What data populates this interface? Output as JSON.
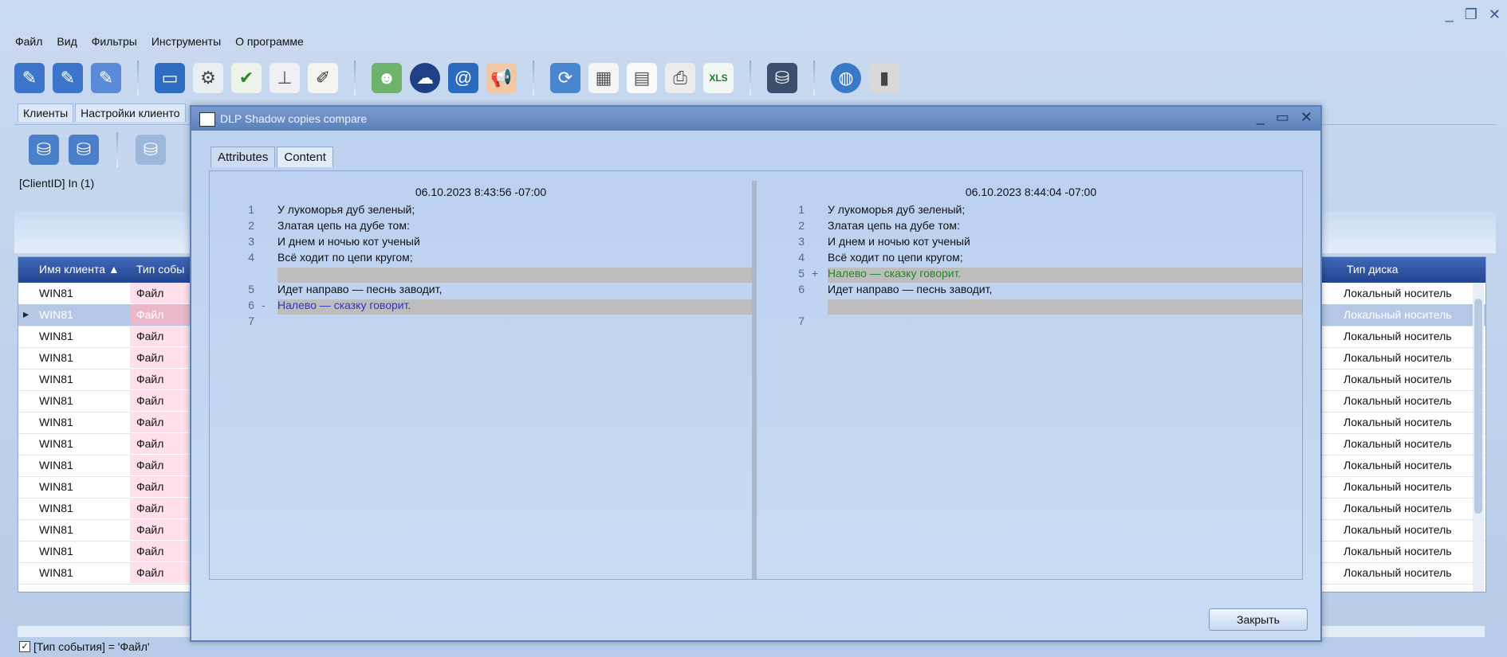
{
  "menubar": [
    "Файл",
    "Вид",
    "Фильтры",
    "Инструменты",
    "О программе"
  ],
  "window_controls": [
    "_",
    "❐",
    "✕"
  ],
  "main_tabs": [
    "Клиенты",
    "Настройки клиенто"
  ],
  "filter_text": "[ClientID] In (1)",
  "grid": {
    "headers": {
      "client": "Имя клиента ▲",
      "event": "Тип собы",
      "disk": "Тип диска"
    },
    "rows": [
      {
        "client": "WIN81",
        "event": "Файл",
        "disk": "Локальный носитель"
      },
      {
        "client": "WIN81",
        "event": "Файл",
        "disk": "Локальный носитель"
      },
      {
        "client": "WIN81",
        "event": "Файл",
        "disk": "Локальный носитель"
      },
      {
        "client": "WIN81",
        "event": "Файл",
        "disk": "Локальный носитель"
      },
      {
        "client": "WIN81",
        "event": "Файл",
        "disk": "Локальный носитель"
      },
      {
        "client": "WIN81",
        "event": "Файл",
        "disk": "Локальный носитель"
      },
      {
        "client": "WIN81",
        "event": "Файл",
        "disk": "Локальный носитель"
      },
      {
        "client": "WIN81",
        "event": "Файл",
        "disk": "Локальный носитель"
      },
      {
        "client": "WIN81",
        "event": "Файл",
        "disk": "Локальный носитель"
      },
      {
        "client": "WIN81",
        "event": "Файл",
        "disk": "Локальный носитель"
      },
      {
        "client": "WIN81",
        "event": "Файл",
        "disk": "Локальный носитель"
      },
      {
        "client": "WIN81",
        "event": "Файл",
        "disk": "Локальный носитель"
      },
      {
        "client": "WIN81",
        "event": "Файл",
        "disk": "Локальный носитель"
      },
      {
        "client": "WIN81",
        "event": "Файл",
        "disk": "Локальный носитель"
      }
    ]
  },
  "status_filter": "[Тип события] = 'Файл'",
  "dialog": {
    "title": "DLP Shadow copies compare",
    "tabs": [
      "Attributes",
      "Content"
    ],
    "left": {
      "timestamp": "06.10.2023 8:43:56 -07:00",
      "lines": [
        {
          "n": "1",
          "mark": "",
          "text": "У лукоморья дуб зеленый;",
          "kind": "normal"
        },
        {
          "n": "2",
          "mark": "",
          "text": "Златая цепь на дубе том:",
          "kind": "normal"
        },
        {
          "n": "3",
          "mark": "",
          "text": "И днем и ночью кот ученый",
          "kind": "normal"
        },
        {
          "n": "4",
          "mark": "",
          "text": "Всё ходит по цепи кругом;",
          "kind": "normal"
        },
        {
          "n": "",
          "mark": "",
          "text": "",
          "kind": "gray"
        },
        {
          "n": "5",
          "mark": "",
          "text": "Идет направо — песнь заводит,",
          "kind": "normal"
        },
        {
          "n": "6",
          "mark": "-",
          "text": "Налево — сказку говорит.",
          "kind": "del"
        },
        {
          "n": "7",
          "mark": "",
          "text": "",
          "kind": "normal"
        }
      ]
    },
    "right": {
      "timestamp": "06.10.2023 8:44:04 -07:00",
      "lines": [
        {
          "n": "1",
          "mark": "",
          "text": "У лукоморья дуб зеленый;",
          "kind": "normal"
        },
        {
          "n": "2",
          "mark": "",
          "text": "Златая цепь на дубе том:",
          "kind": "normal"
        },
        {
          "n": "3",
          "mark": "",
          "text": "И днем и ночью кот ученый",
          "kind": "normal"
        },
        {
          "n": "4",
          "mark": "",
          "text": "Всё ходит по цепи кругом;",
          "kind": "normal"
        },
        {
          "n": "5",
          "mark": "+",
          "text": "Налево — сказку говорит.",
          "kind": "add"
        },
        {
          "n": "6",
          "mark": "",
          "text": "Идет направо — песнь заводит,",
          "kind": "normal"
        },
        {
          "n": "",
          "mark": "",
          "text": "",
          "kind": "gray"
        },
        {
          "n": "7",
          "mark": "",
          "text": "",
          "kind": "normal"
        }
      ]
    },
    "close_label": "Закрыть"
  },
  "toolbar_icons": [
    "script-icon",
    "script-lock-icon",
    "scripts-icon",
    "monitor-icon",
    "settings-doc-icon",
    "checklist-icon",
    "network-icon",
    "note-icon",
    "users-icon",
    "cloud-mask-icon",
    "address-book-icon",
    "megaphone-icon",
    "refresh-icon",
    "table-icon",
    "document-icon",
    "printer-icon",
    "xls-icon",
    "database-icon",
    "globe-icon",
    "usb-icon"
  ]
}
